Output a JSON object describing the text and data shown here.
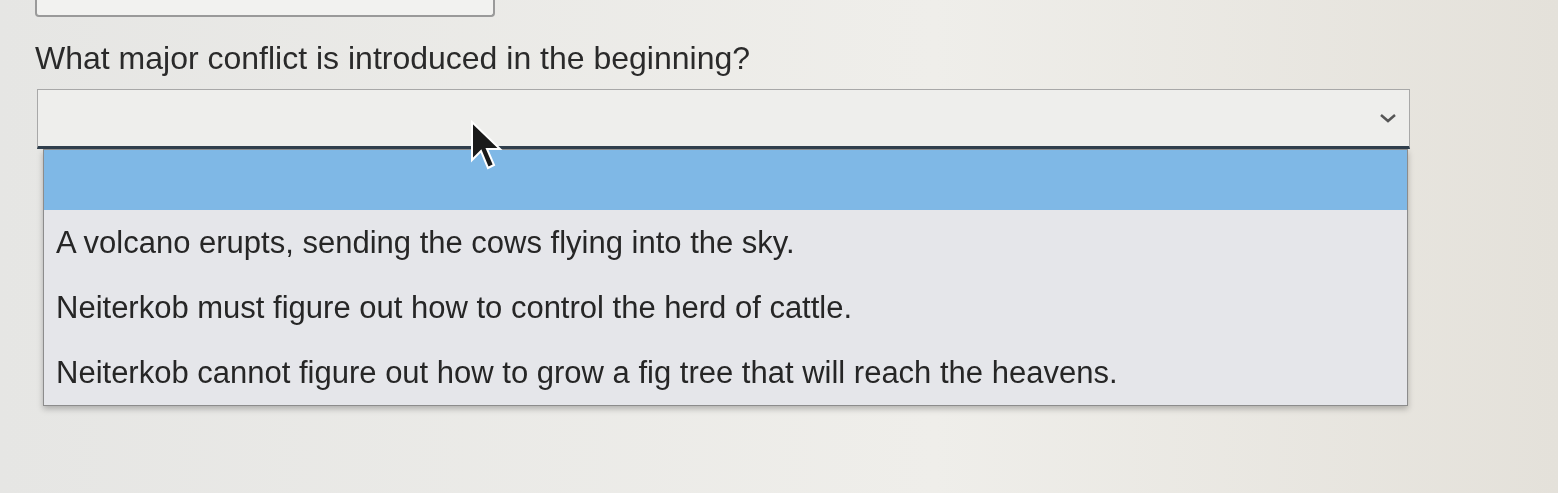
{
  "question": "What major conflict is introduced in the beginning?",
  "select": {
    "expanded": true
  },
  "options": [
    {
      "kind": "blank",
      "selected": true
    },
    {
      "kind": "text",
      "label": "A volcano erupts, sending the cows flying into the sky.",
      "selected": false
    },
    {
      "kind": "text",
      "label": "Neiterkob must figure out how to control the herd of cattle.",
      "selected": false
    },
    {
      "kind": "text",
      "label": "Neiterkob cannot figure out how to grow a fig tree that will reach the heavens.",
      "selected": false
    }
  ]
}
